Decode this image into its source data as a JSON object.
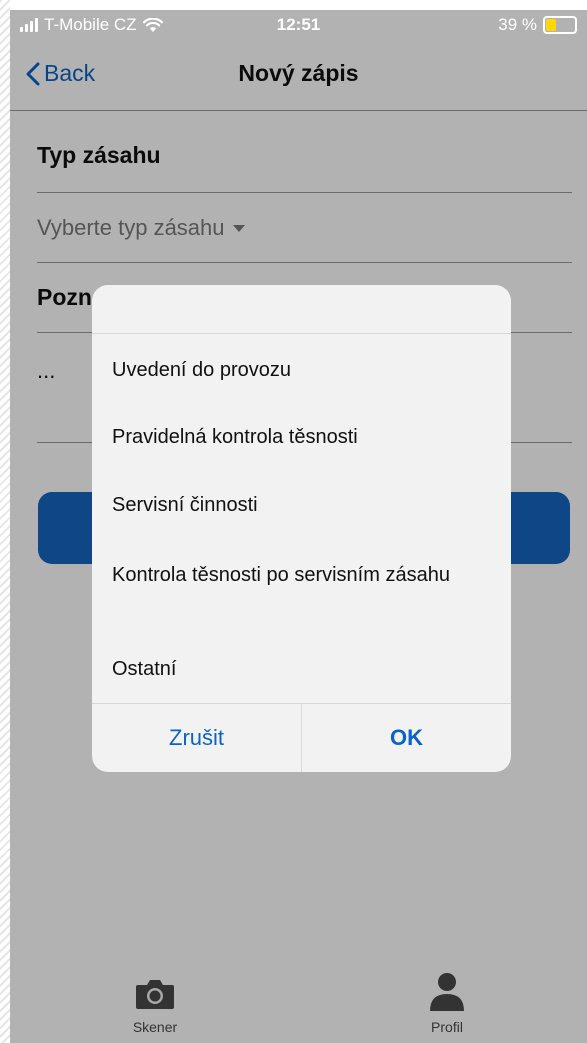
{
  "status": {
    "carrier": "T-Mobile CZ",
    "time": "12:51",
    "battery": "39 %",
    "signal_icon": "signal-icon",
    "wifi_icon": "wifi-icon",
    "battery_icon": "battery-icon",
    "battery_level": 0.39
  },
  "nav": {
    "back_label": "Back",
    "title": "Nový zápis"
  },
  "form": {
    "type_label": "Typ zásahu",
    "type_placeholder": "Vyberte typ zásahu",
    "note_label": "Pozn",
    "note_value": "..."
  },
  "dialog": {
    "options": [
      "Uvedení do provozu",
      "Pravidelná kontrola těsnosti",
      "Servisní činnosti",
      "Kontrola těsnosti po servisním zásahu",
      "Ostatní"
    ],
    "cancel_label": "Zrušit",
    "ok_label": "OK"
  },
  "tabs": {
    "scanner_label": "Skener",
    "profile_label": "Profil"
  },
  "colors": {
    "accent": "#0a63c7",
    "button": "#1565c0",
    "overlay": "rgba(0,0,0,0.30)",
    "battery": "#ffd60a"
  }
}
